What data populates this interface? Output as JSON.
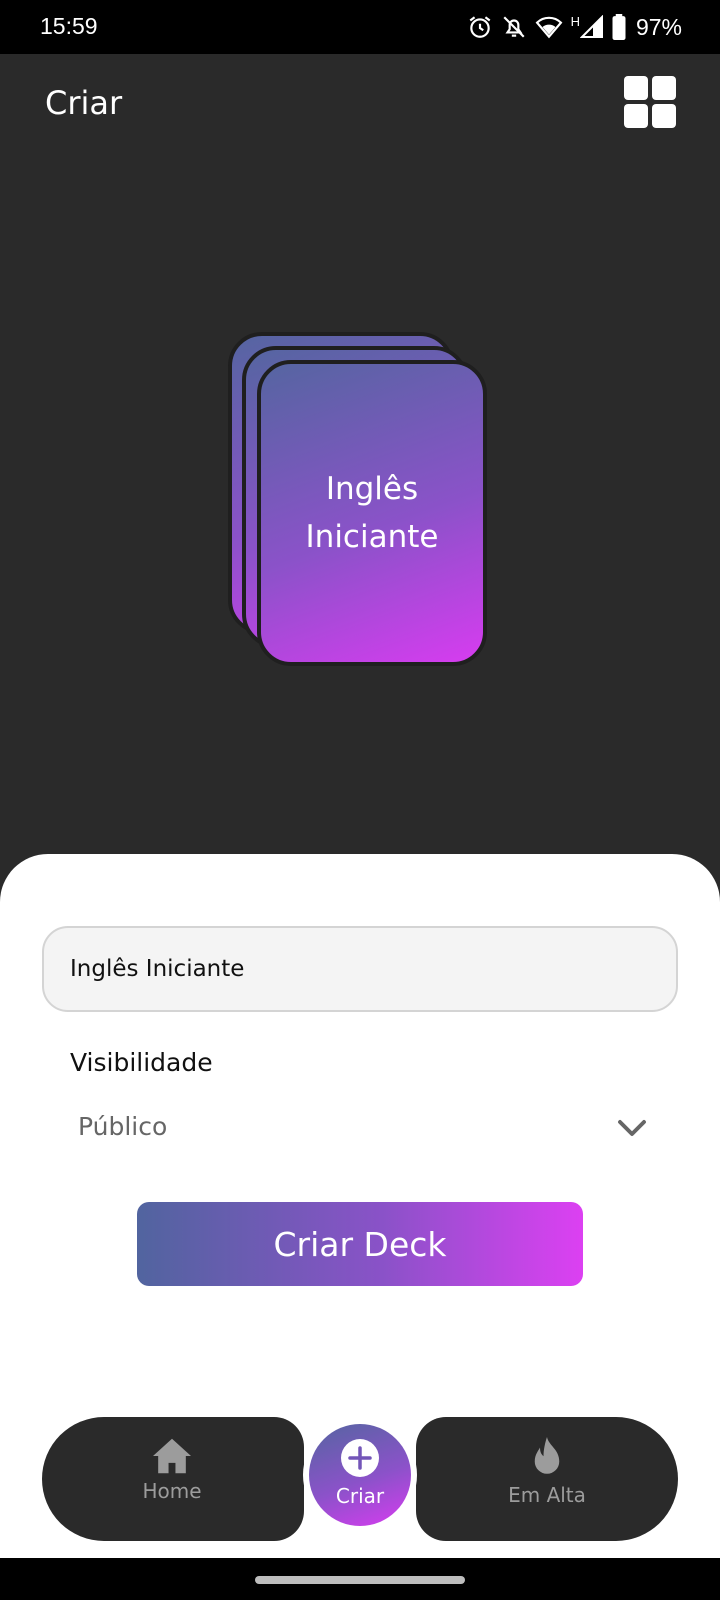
{
  "status_bar": {
    "time": "15:59",
    "network": "H",
    "battery": "97%",
    "icons": [
      "alarm-icon",
      "notifications-off-icon",
      "wifi-icon",
      "signal-icon",
      "battery-icon"
    ]
  },
  "header": {
    "title": "Criar",
    "grid_icon": "grid-icon"
  },
  "deck_preview": {
    "title": "Inglês Iniciante"
  },
  "form": {
    "deck_name_value": "Inglês Iniciante",
    "visibility_label": "Visibilidade",
    "visibility_selected": "Público",
    "submit_label": "Criar Deck"
  },
  "bottom_nav": {
    "items": [
      {
        "label": "Home",
        "icon": "home-icon"
      },
      {
        "label": "Criar",
        "icon": "plus-icon"
      },
      {
        "label": "Em Alta",
        "icon": "flame-icon"
      }
    ]
  },
  "colors": {
    "background": "#2a2a2a",
    "gradient_start": "#5565a1",
    "gradient_end": "#d73cf0",
    "sheet": "#ffffff"
  }
}
